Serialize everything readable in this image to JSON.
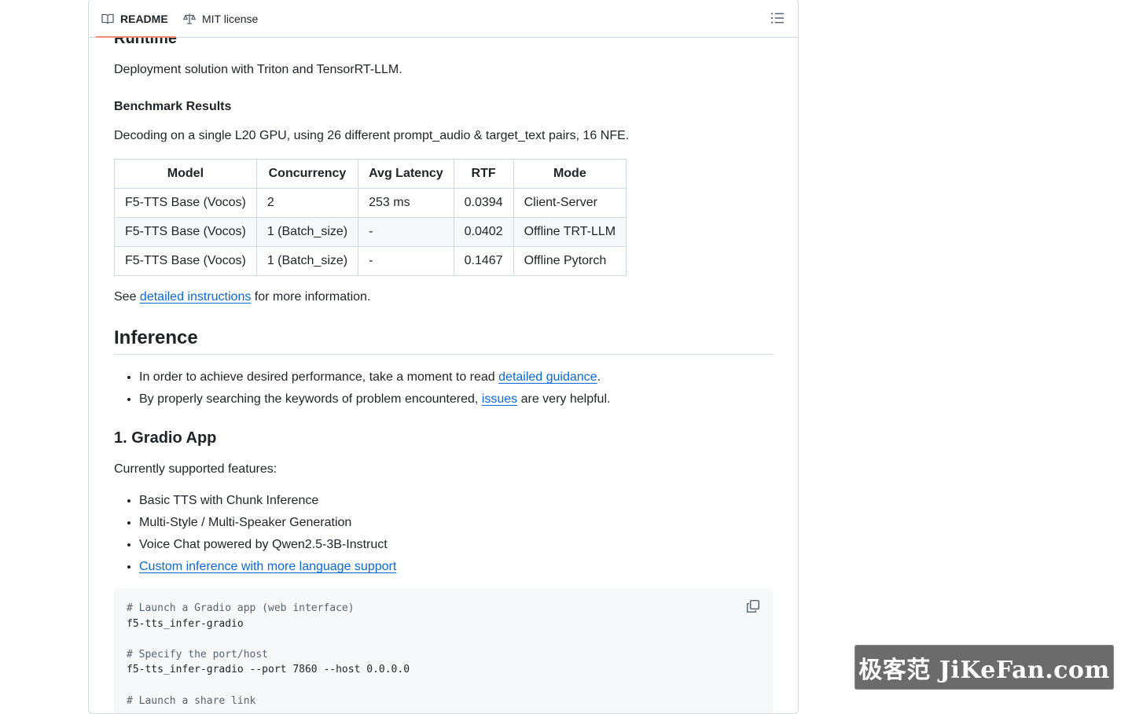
{
  "tabs": {
    "readme": "README",
    "license": "MIT license"
  },
  "content": {
    "cut_heading": "Runtime",
    "runtime_desc": "Deployment solution with Triton and TensorRT-LLM.",
    "benchmark_heading": "Benchmark Results",
    "benchmark_desc": "Decoding on a single L20 GPU, using 26 different prompt_audio & target_text pairs, 16 NFE.",
    "table": {
      "headers": [
        "Model",
        "Concurrency",
        "Avg Latency",
        "RTF",
        "Mode"
      ],
      "rows": [
        [
          "F5-TTS Base (Vocos)",
          "2",
          "253 ms",
          "0.0394",
          "Client-Server"
        ],
        [
          "F5-TTS Base (Vocos)",
          "1 (Batch_size)",
          "-",
          "0.0402",
          "Offline TRT-LLM"
        ],
        [
          "F5-TTS Base (Vocos)",
          "1 (Batch_size)",
          "-",
          "0.1467",
          "Offline Pytorch"
        ]
      ]
    },
    "see_prefix": "See ",
    "see_link": "detailed instructions",
    "see_suffix": " for more information.",
    "inference_heading": "Inference",
    "inference_items": [
      {
        "prefix": "In order to achieve desired performance, take a moment to read ",
        "link": "detailed guidance",
        "suffix": "."
      },
      {
        "prefix": "By properly searching the keywords of problem encountered, ",
        "link": "issues",
        "suffix": " are very helpful."
      }
    ],
    "gradio_heading": "1. Gradio App",
    "gradio_desc": "Currently supported features:",
    "features": [
      "Basic TTS with Chunk Inference",
      "Multi-Style / Multi-Speaker Generation",
      "Voice Chat powered by Qwen2.5-3B-Instruct"
    ],
    "feature_link": "Custom inference with more language support",
    "code": {
      "lines": [
        "# Launch a Gradio app (web interface)",
        "f5-tts_infer-gradio",
        "",
        "# Specify the port/host",
        "f5-tts_infer-gradio --port 7860 --host 0.0.0.0",
        "",
        "# Launch a share link"
      ]
    }
  },
  "watermark": "极客范 JiKeFan.com",
  "colors": {
    "link": "#0969da",
    "tab_underline": "#fd8c73",
    "border": "#d1d9e0",
    "code_bg": "#f6f8fa"
  }
}
